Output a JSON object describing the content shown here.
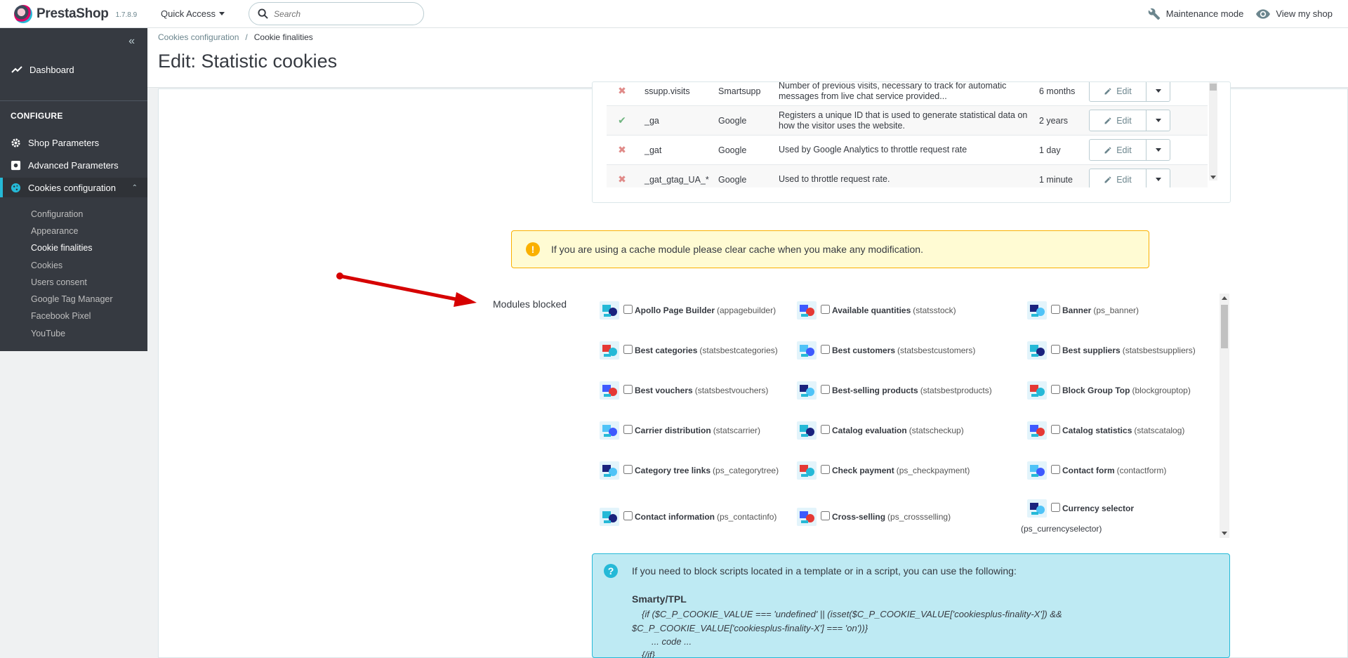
{
  "header": {
    "brand": "PrestaShop",
    "version": "1.7.8.9",
    "quick_access": "Quick Access",
    "search_placeholder": "Search",
    "maintenance": "Maintenance mode",
    "view_shop": "View my shop"
  },
  "sidebar": {
    "dashboard": "Dashboard",
    "section": "CONFIGURE",
    "items": [
      "Shop Parameters",
      "Advanced Parameters",
      "Cookies configuration"
    ],
    "subitems": [
      "Configuration",
      "Appearance",
      "Cookie finalities",
      "Cookies",
      "Users consent",
      "Google Tag Manager",
      "Facebook Pixel",
      "YouTube"
    ]
  },
  "breadcrumb": {
    "parent": "Cookies configuration",
    "sep": "/",
    "current": "Cookie finalities"
  },
  "page_title": "Edit: Statistic cookies",
  "cookies": [
    {
      "status": "no",
      "name": "ssupp.visits",
      "provider": "Smartsupp",
      "description": "Number of previous visits, necessary to track for automatic messages from live chat service provided...",
      "duration": "6 months",
      "action": "Edit"
    },
    {
      "status": "yes",
      "name": "_ga",
      "provider": "Google",
      "description": "Registers a unique ID that is used to generate statistical data on how the visitor uses the website.",
      "duration": "2 years",
      "action": "Edit"
    },
    {
      "status": "no",
      "name": "_gat",
      "provider": "Google",
      "description": "Used by Google Analytics to throttle request rate",
      "duration": "1 day",
      "action": "Edit"
    },
    {
      "status": "no",
      "name": "_gat_gtag_UA_*",
      "provider": "Google",
      "description": "Used to throttle request rate.",
      "duration": "1 minute",
      "action": "Edit"
    }
  ],
  "warning": "If you are using a cache module please clear cache when you make any modification.",
  "modules_label": "Modules blocked",
  "modules": [
    {
      "name": "Apollo Page Builder",
      "tech": "(appagebuilder)",
      "icon": "apollo-icon"
    },
    {
      "name": "Available quantities",
      "tech": "(statsstock)",
      "icon": "stock-icon"
    },
    {
      "name": "Banner",
      "tech": "(ps_banner)",
      "icon": "banner-icon"
    },
    {
      "name": "Best categories",
      "tech": "(statsbestcategories)",
      "icon": "categories-icon"
    },
    {
      "name": "Best customers",
      "tech": "(statsbestcustomers)",
      "icon": "customers-icon"
    },
    {
      "name": "Best suppliers",
      "tech": "(statsbestsuppliers)",
      "icon": "suppliers-icon"
    },
    {
      "name": "Best vouchers",
      "tech": "(statsbestvouchers)",
      "icon": "vouchers-icon"
    },
    {
      "name": "Best-selling products",
      "tech": "(statsbestproducts)",
      "icon": "products-icon"
    },
    {
      "name": "Block Group Top",
      "tech": "(blockgrouptop)",
      "icon": "group-top-icon"
    },
    {
      "name": "Carrier distribution",
      "tech": "(statscarrier)",
      "icon": "carrier-icon"
    },
    {
      "name": "Catalog evaluation",
      "tech": "(statscheckup)",
      "icon": "evaluation-icon"
    },
    {
      "name": "Catalog statistics",
      "tech": "(statscatalog)",
      "icon": "catalog-stats-icon"
    },
    {
      "name": "Category tree links",
      "tech": "(ps_categorytree)",
      "icon": "tree-icon"
    },
    {
      "name": "Check payment",
      "tech": "(ps_checkpayment)",
      "icon": "check-payment-icon"
    },
    {
      "name": "Contact form",
      "tech": "(contactform)",
      "icon": "contact-form-icon"
    },
    {
      "name": "Contact information",
      "tech": "(ps_contactinfo)",
      "icon": "contact-info-icon"
    },
    {
      "name": "Cross-selling",
      "tech": "(ps_crossselling)",
      "icon": "cross-selling-icon"
    },
    {
      "name": "Currency selector",
      "tech": "(ps_currencyselector)",
      "icon": "currency-icon"
    }
  ],
  "info": {
    "intro": "If you need to block scripts located in a template or in a script, you can use the following:",
    "heading": "Smarty/TPL",
    "code_line1": "{if ($C_P_COOKIE_VALUE === 'undefined' || (isset($C_P_COOKIE_VALUE['cookiesplus-finality-X']) && $C_P_COOKIE_VALUE['cookiesplus-finality-X'] === 'on'))}",
    "code_line2": "... code ...",
    "code_line3": "{/if}"
  }
}
